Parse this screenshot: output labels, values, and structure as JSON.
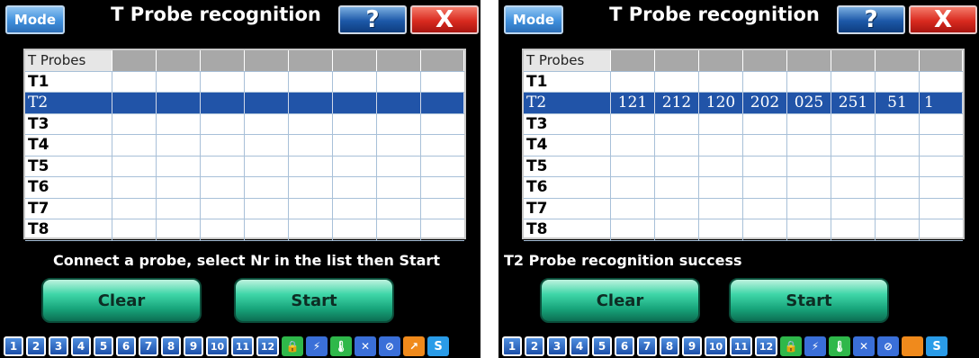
{
  "left_screen": {
    "mode_label": "Mode",
    "title": "T Probe recognition",
    "help_label": "?",
    "close_label": "X",
    "table": {
      "header": "T Probes",
      "rows": [
        {
          "probe": "T1",
          "values": [
            "",
            "",
            "",
            "",
            "",
            "",
            "",
            ""
          ]
        },
        {
          "probe": "T2",
          "values": [
            "",
            "",
            "",
            "",
            "",
            "",
            "",
            ""
          ]
        },
        {
          "probe": "T3",
          "values": [
            "",
            "",
            "",
            "",
            "",
            "",
            "",
            ""
          ]
        },
        {
          "probe": "T4",
          "values": [
            "",
            "",
            "",
            "",
            "",
            "",
            "",
            ""
          ]
        },
        {
          "probe": "T5",
          "values": [
            "",
            "",
            "",
            "",
            "",
            "",
            "",
            ""
          ]
        },
        {
          "probe": "T6",
          "values": [
            "",
            "",
            "",
            "",
            "",
            "",
            "",
            ""
          ]
        },
        {
          "probe": "T7",
          "values": [
            "",
            "",
            "",
            "",
            "",
            "",
            "",
            ""
          ]
        },
        {
          "probe": "T8",
          "values": [
            "",
            "",
            "",
            "",
            "",
            "",
            "",
            ""
          ]
        }
      ],
      "selected_row": "T2"
    },
    "status": "Connect a probe, select Nr in the list then Start",
    "clear_label": "Clear",
    "start_label": "Start"
  },
  "right_screen": {
    "mode_label": "Mode",
    "title": "T Probe recognition",
    "help_label": "?",
    "close_label": "X",
    "table": {
      "header": "T Probes",
      "rows": [
        {
          "probe": "T1",
          "values": [
            "",
            "",
            "",
            "",
            "",
            "",
            "",
            ""
          ]
        },
        {
          "probe": "T2",
          "values": [
            "121",
            "212",
            "120",
            "202",
            "025",
            "251",
            "51",
            "1"
          ]
        },
        {
          "probe": "T3",
          "values": [
            "",
            "",
            "",
            "",
            "",
            "",
            "",
            ""
          ]
        },
        {
          "probe": "T4",
          "values": [
            "",
            "",
            "",
            "",
            "",
            "",
            "",
            ""
          ]
        },
        {
          "probe": "T5",
          "values": [
            "",
            "",
            "",
            "",
            "",
            "",
            "",
            ""
          ]
        },
        {
          "probe": "T6",
          "values": [
            "",
            "",
            "",
            "",
            "",
            "",
            "",
            ""
          ]
        },
        {
          "probe": "T7",
          "values": [
            "",
            "",
            "",
            "",
            "",
            "",
            "",
            ""
          ]
        },
        {
          "probe": "T8",
          "values": [
            "",
            "",
            "",
            "",
            "",
            "",
            "",
            ""
          ]
        }
      ],
      "selected_row": "T2"
    },
    "status": "T2  Probe recognition success",
    "clear_label": "Clear",
    "start_label": "Start"
  },
  "taskbar": {
    "numbers": [
      "1",
      "2",
      "3",
      "4",
      "5",
      "6",
      "7",
      "8",
      "9",
      "10",
      "11",
      "12"
    ],
    "left_icons": [
      {
        "name": "lock-icon",
        "color": "#2fb84a"
      },
      {
        "name": "link-error-icon",
        "color": "#3a6fd8"
      },
      {
        "name": "thermometer-icon",
        "color": "#2fb84a"
      },
      {
        "name": "sensor-error-icon",
        "color": "#3a6fd8"
      },
      {
        "name": "disabled-icon",
        "color": "#3a6fd8"
      },
      {
        "name": "arrow-icon",
        "color": "#f08a1c"
      },
      {
        "name": "s-icon",
        "color": "#2a9ce8"
      }
    ],
    "right_icons": [
      {
        "name": "lock-icon",
        "color": "#2fb84a"
      },
      {
        "name": "link-error-icon",
        "color": "#3a6fd8"
      },
      {
        "name": "thermometer-icon",
        "color": "#2fb84a"
      },
      {
        "name": "sensor-error-icon",
        "color": "#3a6fd8"
      },
      {
        "name": "disabled-icon",
        "color": "#3a6fd8"
      },
      {
        "name": "orange-square-icon",
        "color": "#f08a1c"
      },
      {
        "name": "s-icon",
        "color": "#2a9ce8"
      }
    ],
    "s_label": "S"
  }
}
